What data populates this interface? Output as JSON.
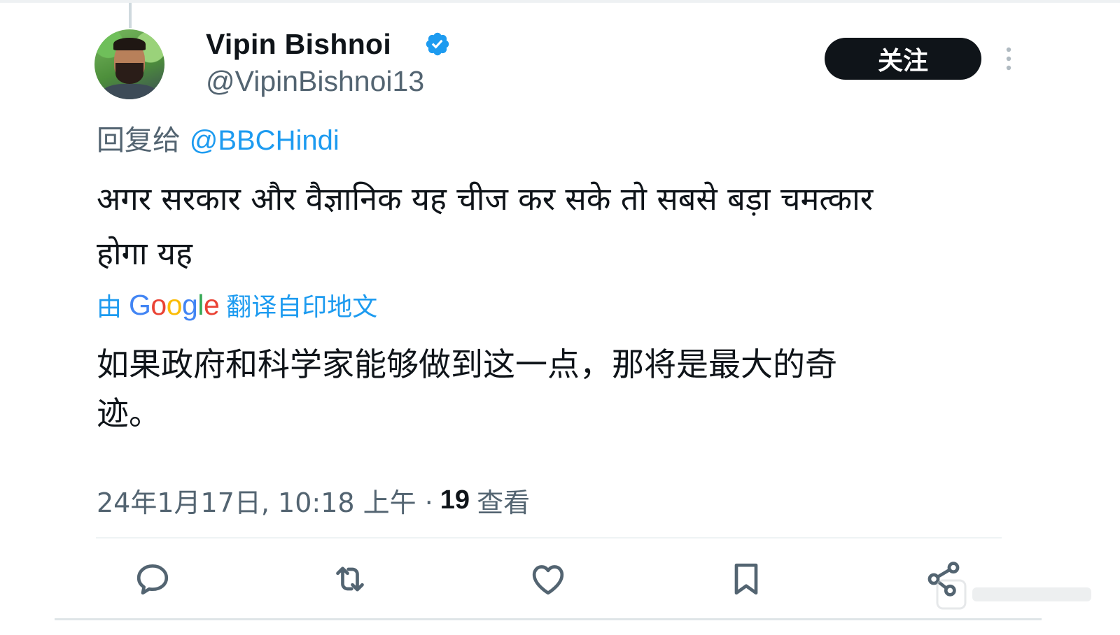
{
  "tweet": {
    "display_name": "Vipin Bishnoi",
    "handle": "@VipinBishnoi13",
    "follow_label": "关注",
    "reply_prefix": "回复给",
    "reply_mention": "@BBCHindi",
    "text_line1": "अगर सरकार और वैज्ञानिक यह चीज कर सके तो सबसे बड़ा चमत्कार",
    "text_line2": "होगा यह",
    "translate_prefix": "由",
    "translate_google_letters": [
      "G",
      "o",
      "o",
      "g",
      "l",
      "e"
    ],
    "translate_suffix": "翻译自印地文",
    "translated_line1": "如果政府和科学家能够做到这一点，那将是最大的奇",
    "translated_line2": "迹。",
    "timestamp": "24年1月17日, 10:18 上午 ·",
    "views_count": "19",
    "views_label": "查看"
  },
  "icons": {
    "verified": "verified-badge-icon",
    "more": "more-dots-icon",
    "reply": "reply-icon",
    "retweet": "retweet-icon",
    "like": "like-icon",
    "bookmark": "bookmark-icon",
    "share": "share-icon"
  },
  "colors": {
    "accent": "#1d9bf0",
    "text": "#0f1419",
    "secondary": "#536471",
    "follow_bg": "#0f1419"
  }
}
